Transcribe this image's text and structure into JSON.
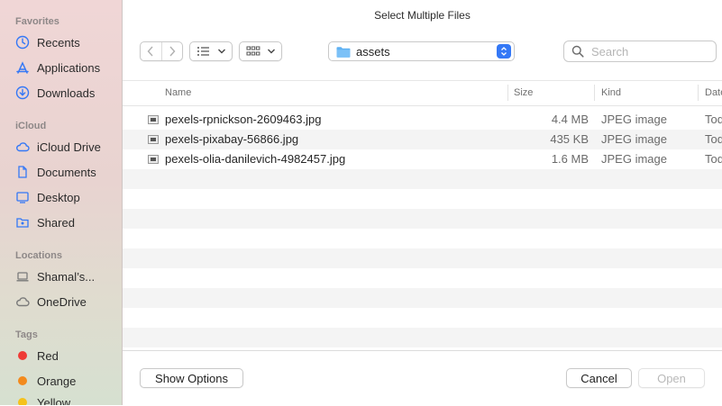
{
  "window": {
    "title": "Select Multiple Files"
  },
  "sidebar": {
    "favorites_label": "Favorites",
    "favorites": [
      {
        "label": "Recents",
        "icon": "clock-icon"
      },
      {
        "label": "Applications",
        "icon": "applications-icon"
      },
      {
        "label": "Downloads",
        "icon": "download-icon"
      }
    ],
    "icloud_label": "iCloud",
    "icloud": [
      {
        "label": "iCloud Drive",
        "icon": "cloud-icon"
      },
      {
        "label": "Documents",
        "icon": "document-icon"
      },
      {
        "label": "Desktop",
        "icon": "desktop-icon"
      },
      {
        "label": "Shared",
        "icon": "shared-folder-icon"
      }
    ],
    "locations_label": "Locations",
    "locations": [
      {
        "label": "Shamal’s...",
        "icon": "laptop-icon"
      },
      {
        "label": "OneDrive",
        "icon": "cloud-icon"
      }
    ],
    "tags_label": "Tags",
    "tags": [
      {
        "label": "Red",
        "color": "#ef3b36"
      },
      {
        "label": "Orange",
        "color": "#f38a1d"
      },
      {
        "label": "Yellow",
        "color": "#f5c21b"
      }
    ]
  },
  "toolbar": {
    "location": "assets",
    "search_placeholder": "Search"
  },
  "columns": {
    "name": "Name",
    "size": "Size",
    "kind": "Kind",
    "date": "Date"
  },
  "files": [
    {
      "name": "pexels-rpnickson-2609463.jpg",
      "size": "4.4 MB",
      "kind": "JPEG image",
      "date": "Tod"
    },
    {
      "name": "pexels-pixabay-56866.jpg",
      "size": "435 KB",
      "kind": "JPEG image",
      "date": "Tod"
    },
    {
      "name": "pexels-olia-danilevich-4982457.jpg",
      "size": "1.6 MB",
      "kind": "JPEG image",
      "date": "Tod"
    }
  ],
  "buttons": {
    "options": "Show Options",
    "cancel": "Cancel",
    "open": "Open"
  },
  "colors": {
    "accent": "#3478f6",
    "folder": "#5fb1f3"
  }
}
